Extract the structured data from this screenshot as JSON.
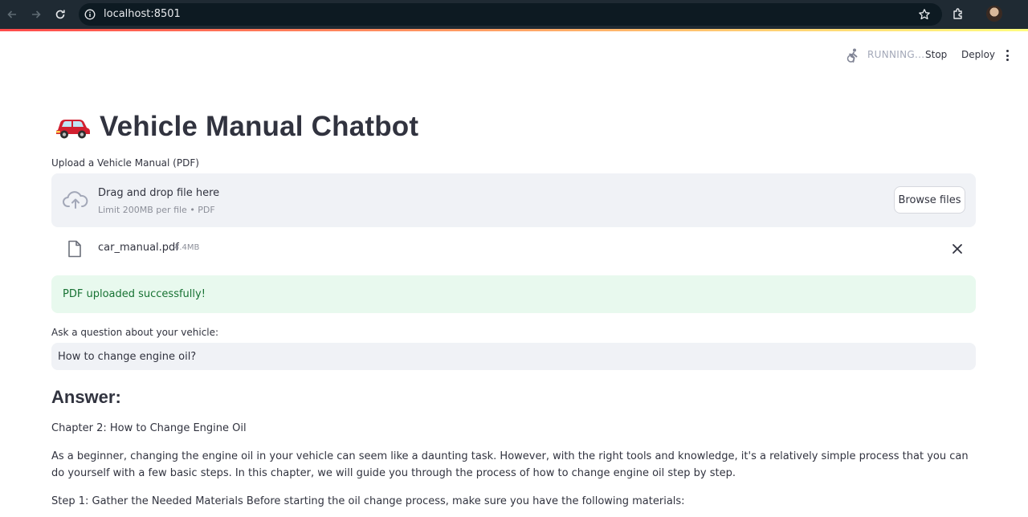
{
  "browser": {
    "url": "localhost:8501"
  },
  "toolbar": {
    "status": "RUNNING...",
    "stop_label": "Stop",
    "deploy_label": "Deploy"
  },
  "page": {
    "title_emoji": "car-icon",
    "title": "Vehicle Manual Chatbot"
  },
  "uploader": {
    "label": "Upload a Vehicle Manual (PDF)",
    "drag_text": "Drag and drop file here",
    "limit_text": "Limit 200MB per file • PDF",
    "browse_label": "Browse files",
    "file": {
      "name": "car_manual.pdf",
      "size": "4.4MB"
    }
  },
  "alert": {
    "success_text": "PDF uploaded successfully!"
  },
  "question": {
    "label": "Ask a question about your vehicle:",
    "value": "How to change engine oil?"
  },
  "answer": {
    "heading": "Answer:",
    "paragraphs": [
      "Chapter 2: How to Change Engine Oil",
      "As a beginner, changing the engine oil in your vehicle can seem like a daunting task. However, with the right tools and knowledge, it's a relatively simple process that you can do yourself with a few basic steps. In this chapter, we will guide you through the process of how to change engine oil step by step.",
      "Step 1: Gather the Needed Materials Before starting the oil change process, make sure you have the following materials:"
    ]
  },
  "colors": {
    "accent": "#ff4b4b",
    "success_bg": "#e8f9ee",
    "success_text": "#177233",
    "input_bg": "#f0f2f6"
  }
}
